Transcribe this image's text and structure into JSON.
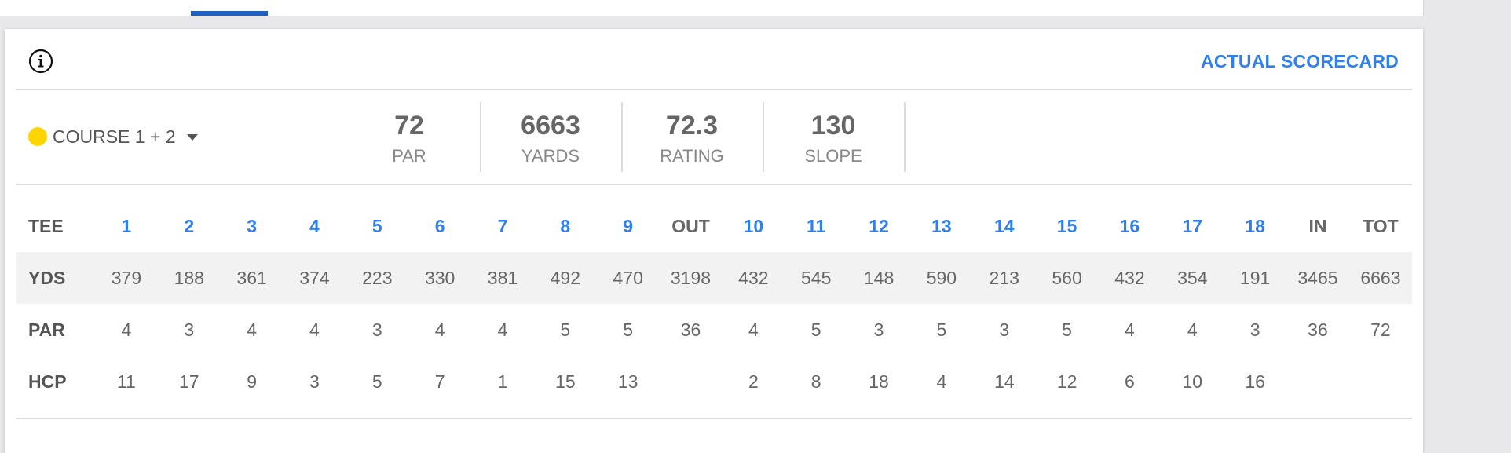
{
  "header": {
    "actual_scorecard_label": "ACTUAL SCORECARD",
    "info_icon": "info-circle-icon"
  },
  "course": {
    "name": "COURSE 1 + 2",
    "dot_color": "#ffd500"
  },
  "stats": [
    {
      "value": "72",
      "label": "PAR"
    },
    {
      "value": "6663",
      "label": "YARDS"
    },
    {
      "value": "72.3",
      "label": "RATING"
    },
    {
      "value": "130",
      "label": "SLOPE"
    }
  ],
  "scorecard": {
    "columns": [
      "TEE",
      "1",
      "2",
      "3",
      "4",
      "5",
      "6",
      "7",
      "8",
      "9",
      "OUT",
      "10",
      "11",
      "12",
      "13",
      "14",
      "15",
      "16",
      "17",
      "18",
      "IN",
      "TOT"
    ],
    "rows": [
      {
        "label": "YDS",
        "values": [
          "379",
          "188",
          "361",
          "374",
          "223",
          "330",
          "381",
          "492",
          "470",
          "3198",
          "432",
          "545",
          "148",
          "590",
          "213",
          "560",
          "432",
          "354",
          "191",
          "3465",
          "6663"
        ]
      },
      {
        "label": "PAR",
        "values": [
          "4",
          "3",
          "4",
          "4",
          "3",
          "4",
          "4",
          "5",
          "5",
          "36",
          "4",
          "5",
          "3",
          "5",
          "3",
          "5",
          "4",
          "4",
          "3",
          "36",
          "72"
        ]
      },
      {
        "label": "HCP",
        "values": [
          "11",
          "17",
          "9",
          "3",
          "5",
          "7",
          "1",
          "15",
          "13",
          "",
          "2",
          "8",
          "18",
          "4",
          "14",
          "12",
          "6",
          "10",
          "16",
          "",
          ""
        ]
      }
    ]
  },
  "colors": {
    "accent": "#2f80ed",
    "tab_indicator": "#1f5fbf",
    "shaded_row": "#f2f2f2"
  }
}
